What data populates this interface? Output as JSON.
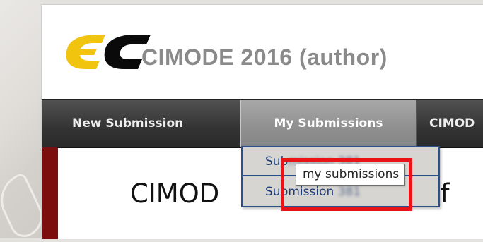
{
  "app": {
    "title": "CIMODE 2016 (author)",
    "logo_text": "EC"
  },
  "nav": {
    "items": [
      {
        "label": "New Submission"
      },
      {
        "label": "My Submissions"
      },
      {
        "label": "CIMOD"
      }
    ]
  },
  "dropdown": {
    "items": [
      {
        "label_visible": "Sub",
        "label_blurred": "mission 381"
      },
      {
        "label_visible": "Submission",
        "label_blurred": "381"
      }
    ]
  },
  "tooltip": {
    "text": "my submissions"
  },
  "page": {
    "heading_left": "CIMOD",
    "heading_right": "n f"
  },
  "colors": {
    "logo_yellow": "#F1C40F",
    "logo_black": "#0a0a0a",
    "navbar_dark": "#333333",
    "nav_active": "#8f8f8f",
    "dropdown_bg": "#d7d5d1",
    "dropdown_border": "#2e4e8a",
    "highlight_red": "#e8141a",
    "sidebar_red": "#7d0e0e"
  }
}
